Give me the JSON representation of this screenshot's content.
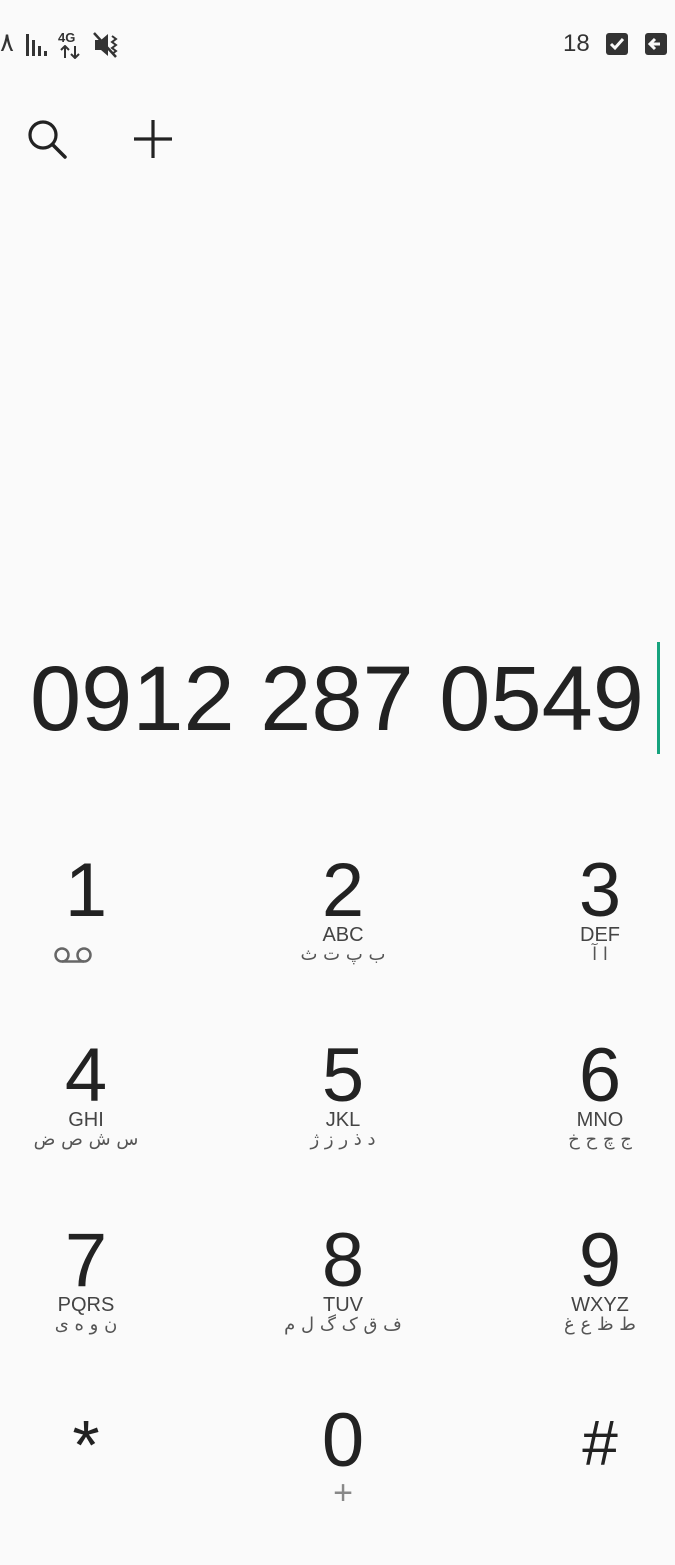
{
  "status_bar": {
    "time": "٨",
    "network_type": "4G",
    "battery_level": "18"
  },
  "toolbar": {
    "search_icon": "search-icon",
    "add_icon": "plus-icon"
  },
  "dialer": {
    "number": "0912 287 0549"
  },
  "keypad": {
    "keys": [
      {
        "digit": "1",
        "latin": "",
        "persian": "",
        "icon": "voicemail-icon"
      },
      {
        "digit": "2",
        "latin": "ABC",
        "persian": "ب پ ت ث"
      },
      {
        "digit": "3",
        "latin": "DEF",
        "persian": "ا آ"
      },
      {
        "digit": "4",
        "latin": "GHI",
        "persian": "س ش ص ض"
      },
      {
        "digit": "5",
        "latin": "JKL",
        "persian": "د ذ ر ز ژ"
      },
      {
        "digit": "6",
        "latin": "MNO",
        "persian": "ج چ ح خ"
      },
      {
        "digit": "7",
        "latin": "PQRS",
        "persian": "ن و ه ی"
      },
      {
        "digit": "8",
        "latin": "TUV",
        "persian": "ف ق ک گ ل م"
      },
      {
        "digit": "9",
        "latin": "WXYZ",
        "persian": "ط ظ ع غ"
      },
      {
        "digit": "*",
        "latin": "",
        "persian": ""
      },
      {
        "digit": "0",
        "latin": "",
        "persian": "",
        "sub": "+"
      },
      {
        "digit": "#",
        "latin": "",
        "persian": ""
      }
    ]
  },
  "colors": {
    "cursor": "#17a37e",
    "background": "#fafafa",
    "text": "#222222"
  }
}
